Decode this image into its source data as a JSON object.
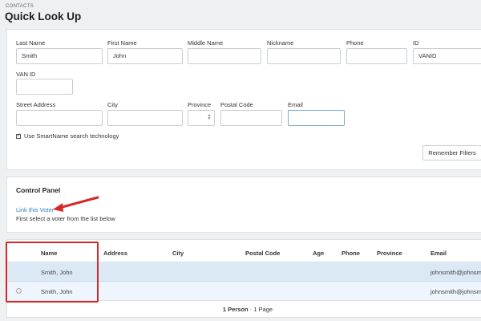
{
  "header": {
    "breadcrumb": "CONTACTS",
    "title": "Quick Look Up"
  },
  "search_form": {
    "fields": {
      "last_name": {
        "label": "Last Name",
        "value": "Smith"
      },
      "first_name": {
        "label": "First Name",
        "value": "John"
      },
      "middle_name": {
        "label": "Middle Name",
        "value": ""
      },
      "nickname": {
        "label": "Nickname",
        "value": ""
      },
      "phone": {
        "label": "Phone",
        "value": ""
      },
      "id": {
        "label": "ID",
        "value": "VANID"
      },
      "van_id": {
        "label": "VAN ID",
        "value": ""
      },
      "street_address": {
        "label": "Street Address",
        "value": ""
      },
      "city": {
        "label": "City",
        "value": ""
      },
      "province": {
        "label": "Province",
        "value": ""
      },
      "postal_code": {
        "label": "Postal Code",
        "value": ""
      },
      "email": {
        "label": "Email",
        "value": ""
      }
    },
    "smartname_label": "Use SmartName search technology",
    "smartname_checked": true,
    "remember_filters_label": "Remember Filters"
  },
  "control_panel": {
    "title": "Control Panel",
    "link_voter": "Link this Voter",
    "instruction": "First select a voter from the list below"
  },
  "results": {
    "columns": [
      "Name",
      "Address",
      "City",
      "Postal Code",
      "Age",
      "Phone",
      "Province",
      "Email"
    ],
    "rows": [
      {
        "name": "Smith, John",
        "email": "johnsmith@johnsmi",
        "selected": true
      },
      {
        "name": "Smith, John",
        "email": "johnsmith@johnsmi",
        "selected": false
      }
    ],
    "footer_count": "1 Person",
    "footer_sep": " · ",
    "footer_pages": "1 Page"
  },
  "colors": {
    "link": "#2f7dc2",
    "highlight": "#d62828",
    "selected_row": "#dbe9f7"
  }
}
